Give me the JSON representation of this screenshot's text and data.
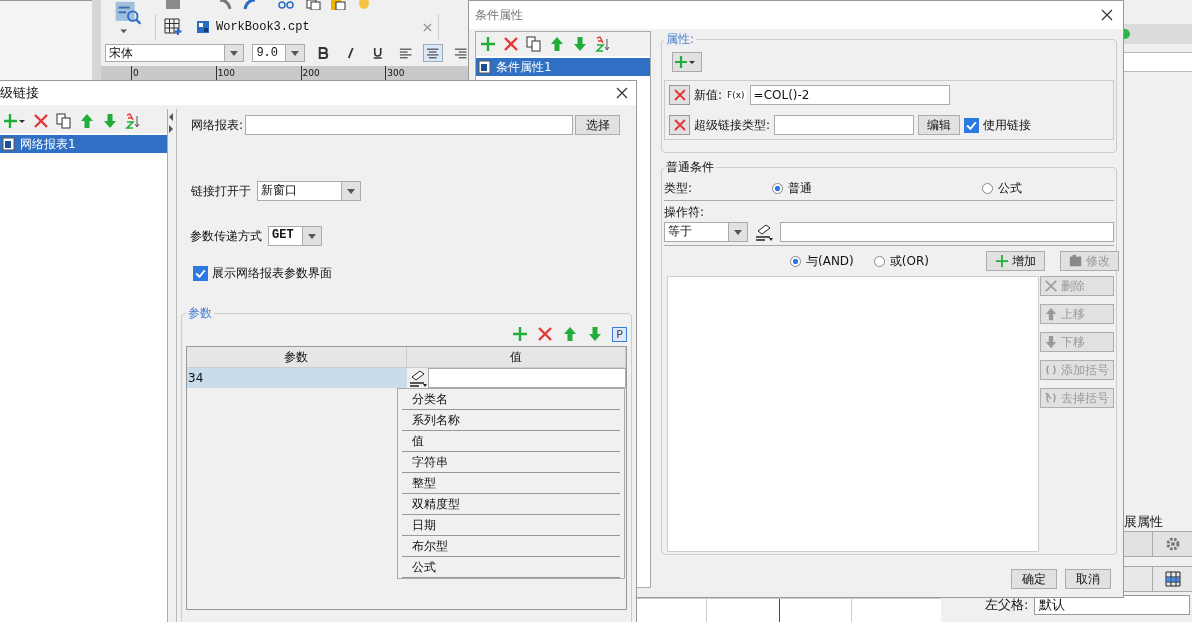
{
  "designer": {
    "tab_title": "WorkBook3.cpt",
    "font": "宋体",
    "font_size": "9.0",
    "ruler_ticks": [
      "0",
      "100",
      "200",
      "300"
    ],
    "panel_title": "展属性",
    "left_parent_label": "左父格:",
    "left_parent_value": "默认"
  },
  "condition_dialog": {
    "title": "条件属性",
    "tree": [
      {
        "label": "条件属性1",
        "selected": true
      }
    ],
    "attr_title": "属性:",
    "new_value_label": "新值:",
    "formula_icon": "F(x)",
    "new_value": "=COL()-2",
    "link_type_label": "超级链接类型:",
    "edit_button": "编辑",
    "use_link": {
      "label": "使用链接",
      "checked": true
    },
    "common_title": "普通条件",
    "type_label": "类型:",
    "type_options": [
      {
        "label": "普通",
        "selected": true
      },
      {
        "label": "公式",
        "selected": false
      }
    ],
    "operator_label": "操作符:",
    "operator_value": "等于",
    "join_options": [
      {
        "label": "与(AND)",
        "selected": true
      },
      {
        "label": "或(OR)",
        "selected": false
      }
    ],
    "action_buttons": [
      {
        "kind": "add",
        "label": "增加",
        "disabled": false
      },
      {
        "kind": "modify",
        "label": "修改",
        "disabled": true
      }
    ],
    "list_buttons": [
      {
        "kind": "delete",
        "label": "删除",
        "disabled": true
      },
      {
        "kind": "up",
        "label": "上移",
        "disabled": true
      },
      {
        "kind": "down",
        "label": "下移",
        "disabled": true
      },
      {
        "kind": "brackets",
        "label": "添加括号",
        "disabled": true
      },
      {
        "kind": "unbracket",
        "label": "去掉括号",
        "disabled": true
      }
    ],
    "ok_button": "确定",
    "cancel_button": "取消"
  },
  "hyperlink_dialog": {
    "title": "级链接",
    "tree": [
      {
        "label": "网络报表1",
        "selected": true
      }
    ],
    "report_label": "网络报表:",
    "select_button": "选择",
    "open_in_label": "链接打开于",
    "open_in_value": "新窗口",
    "method_label": "参数传递方式",
    "method_value": "GET",
    "show_params": {
      "label": "展示网络报表参数界面",
      "checked": true
    },
    "params_title": "参数",
    "param_button": "P",
    "columns": [
      "参数",
      "值"
    ],
    "rows": [
      {
        "param": "34",
        "selected": true
      }
    ],
    "type_menu": [
      "分类名",
      "系列名称",
      "值",
      "字符串",
      "整型",
      "双精度型",
      "日期",
      "布尔型",
      "公式"
    ]
  }
}
